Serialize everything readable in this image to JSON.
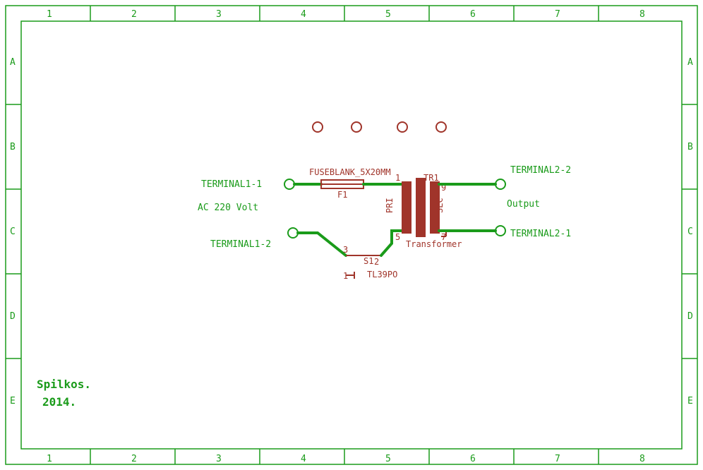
{
  "frame": {
    "cols": [
      "1",
      "2",
      "3",
      "4",
      "5",
      "6",
      "7",
      "8"
    ],
    "rows": [
      "A",
      "B",
      "C",
      "D",
      "E"
    ]
  },
  "title": {
    "author": "Spilkos.",
    "year": "2014."
  },
  "labels": {
    "term11": "TERMINAL1-1",
    "term12": "TERMINAL1-2",
    "term21": "TERMINAL2-1",
    "term22": "TERMINAL2-2",
    "acnote": "AC 220 Volt",
    "output": "Output"
  },
  "components": {
    "fuse": {
      "ref": "F1",
      "value": "FUSEBLANK_5X20MM"
    },
    "switch": {
      "ref": "S1",
      "value": "TL39PO",
      "pin1": "1",
      "pin2": "2",
      "pin3": "3"
    },
    "transformer": {
      "ref": "TR1",
      "value": "Transformer",
      "pri": "PRI",
      "sec": "SEC",
      "p1": "1",
      "p5": "5",
      "p7": "7",
      "p9": "9"
    }
  }
}
